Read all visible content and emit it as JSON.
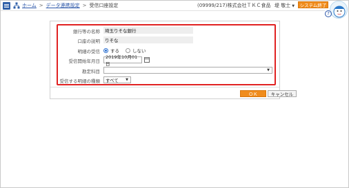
{
  "header": {
    "breadcrumb": [
      {
        "label": "ホーム",
        "link": true
      },
      {
        "label": "データ連携設定",
        "link": true
      },
      {
        "label": "受信口座設定",
        "link": false
      }
    ],
    "separator": ">",
    "company": "(09999/217)株式会社ＴＫＣ食品",
    "user": "堤 敬士",
    "exit_label": "システム終了",
    "help": "?"
  },
  "form": {
    "bank_name": {
      "label": "銀行等の名称",
      "value": "埼玉りそな銀行"
    },
    "account_desc": {
      "label": "口座の説明",
      "value": "りそな"
    },
    "detail_receive": {
      "label": "明細の受信",
      "options": [
        "する",
        "しない"
      ],
      "selected": "する"
    },
    "start_date": {
      "label": "受信開始年月日",
      "value": "2019年10月01日"
    },
    "account_item": {
      "label": "勘定科目",
      "value": ""
    },
    "detail_type": {
      "label": "受信する明細の種類",
      "value": "すべて"
    }
  },
  "actions": {
    "ok_label": "ＯＫ",
    "cancel_label": "キャンセル"
  },
  "colors": {
    "accent": "#f08c1c",
    "link": "#2a55a8",
    "highlight": "#e02020"
  }
}
